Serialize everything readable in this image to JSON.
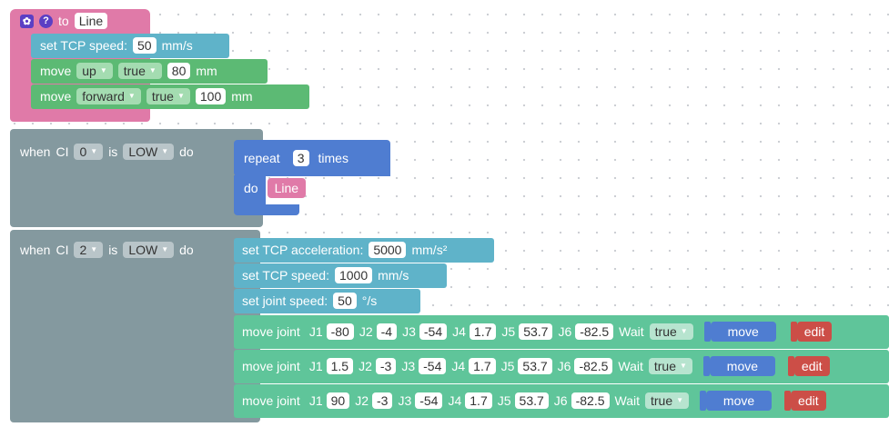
{
  "proc": {
    "prefix": "to",
    "name": "Line",
    "tcp_speed": {
      "label": "set TCP speed:",
      "value": "50",
      "unit": "mm/s"
    },
    "move1": {
      "label": "move",
      "dir": "up",
      "rel": "true",
      "value": "80",
      "unit": "mm"
    },
    "move2": {
      "label": "move",
      "dir": "forward",
      "rel": "true",
      "value": "100",
      "unit": "mm"
    }
  },
  "when1": {
    "when": "when",
    "ci": "CI",
    "pin": "0",
    "is": "is",
    "level": "LOW",
    "do": "do",
    "repeat": {
      "label": "repeat",
      "count": "3",
      "times": "times",
      "do": "do",
      "call": "Line"
    }
  },
  "when2": {
    "when": "when",
    "ci": "CI",
    "pin": "2",
    "is": "is",
    "level": "LOW",
    "do": "do",
    "accel": {
      "label": "set TCP acceleration:",
      "value": "5000",
      "unit": "mm/s²"
    },
    "speed": {
      "label": "set TCP speed:",
      "value": "1000",
      "unit": "mm/s"
    },
    "joint_speed": {
      "label": "set joint speed:",
      "value": "50",
      "unit": "°/s"
    },
    "moves": [
      {
        "label": "move joint",
        "j1": "-80",
        "j2": "-4",
        "j3": "-54",
        "j4": "1.7",
        "j5": "53.7",
        "j6": "-82.5",
        "wait": "Wait",
        "wait_val": "true",
        "move": "move",
        "edit": "edit"
      },
      {
        "label": "move joint",
        "j1": "1.5",
        "j2": "-3",
        "j3": "-54",
        "j4": "1.7",
        "j5": "53.7",
        "j6": "-82.5",
        "wait": "Wait",
        "wait_val": "true",
        "move": "move",
        "edit": "edit"
      },
      {
        "label": "move joint",
        "j1": "90",
        "j2": "-3",
        "j3": "-54",
        "j4": "1.7",
        "j5": "53.7",
        "j6": "-82.5",
        "wait": "Wait",
        "wait_val": "true",
        "move": "move",
        "edit": "edit"
      }
    ],
    "joint_labels": [
      "J1",
      "J2",
      "J3",
      "J4",
      "J5",
      "J6"
    ]
  },
  "icons": {
    "settings": "gear-icon",
    "help": "help-icon"
  },
  "colors": {
    "procedure": "#e07aa8",
    "speed_block": "#5fb3c9",
    "move_block": "#5cba74",
    "event_block": "#84999f",
    "loop_block": "#4f7dd1",
    "joint_block": "#5fc59a",
    "edit_button": "#cc4e47"
  }
}
